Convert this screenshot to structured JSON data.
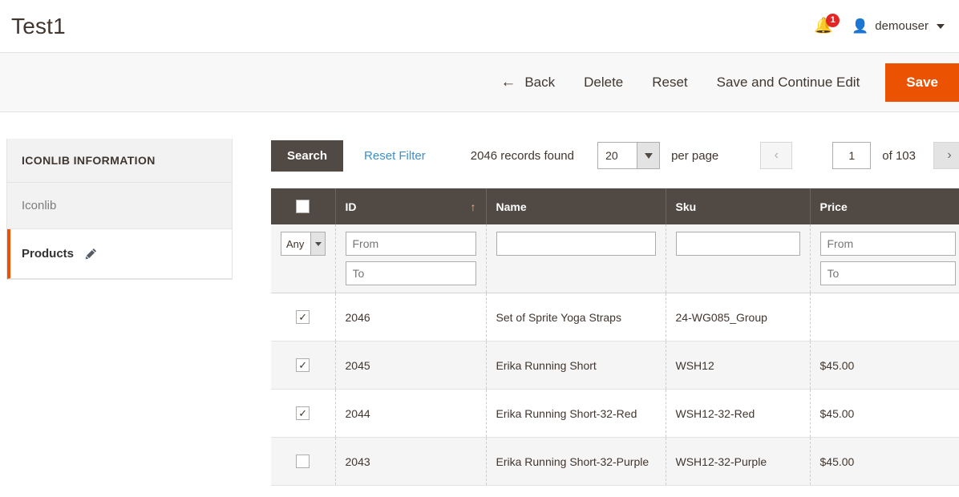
{
  "header": {
    "title": "Test1",
    "notification": {
      "icon": "bell-icon",
      "count": "1"
    },
    "user": {
      "icon": "user-avatar-icon",
      "name": "demouser"
    }
  },
  "toolbar": {
    "back_label": "Back",
    "back_icon": "arrow-left-icon",
    "delete_label": "Delete",
    "reset_label": "Reset",
    "save_continue_label": "Save and Continue Edit",
    "save_label": "Save",
    "save_color": "#eb5202"
  },
  "sidebar": {
    "title": "ICONLIB INFORMATION",
    "items": [
      {
        "label": "Iconlib",
        "active": false
      },
      {
        "label": "Products",
        "active": true,
        "icon": "pencil-icon"
      }
    ],
    "active_accent": "#eb5202"
  },
  "grid_toolbar": {
    "search_label": "Search",
    "reset_filter_label": "Reset Filter",
    "records_found": "2046 records found",
    "per_page_value": "20",
    "per_page_label": "per page",
    "prev_icon": "chevron-left-icon",
    "next_icon": "chevron-right-icon",
    "page_value": "1",
    "of_pages": "of 103"
  },
  "grid": {
    "columns": [
      {
        "key": "check",
        "label": ""
      },
      {
        "key": "id",
        "label": "ID",
        "sorted": "asc",
        "sort_icon": "arrow-up-icon"
      },
      {
        "key": "name",
        "label": "Name"
      },
      {
        "key": "sku",
        "label": "Sku"
      },
      {
        "key": "price",
        "label": "Price"
      }
    ],
    "filters": {
      "any_label": "Any",
      "id_from_placeholder": "From",
      "id_to_placeholder": "To",
      "name_value": "",
      "sku_value": "",
      "price_from_placeholder": "From",
      "price_to_placeholder": "To"
    },
    "rows": [
      {
        "checked": "✓",
        "id": "2046",
        "name": "Set of Sprite Yoga Straps",
        "sku": "24-WG085_Group",
        "price": ""
      },
      {
        "checked": "✓",
        "id": "2045",
        "name": "Erika Running Short",
        "sku": "WSH12",
        "price": "$45.00"
      },
      {
        "checked": "✓",
        "id": "2044",
        "name": "Erika Running Short-32-Red",
        "sku": "WSH12-32-Red",
        "price": "$45.00"
      },
      {
        "checked": "",
        "id": "2043",
        "name": "Erika Running Short-32-Purple",
        "sku": "WSH12-32-Purple",
        "price": "$45.00"
      }
    ]
  }
}
